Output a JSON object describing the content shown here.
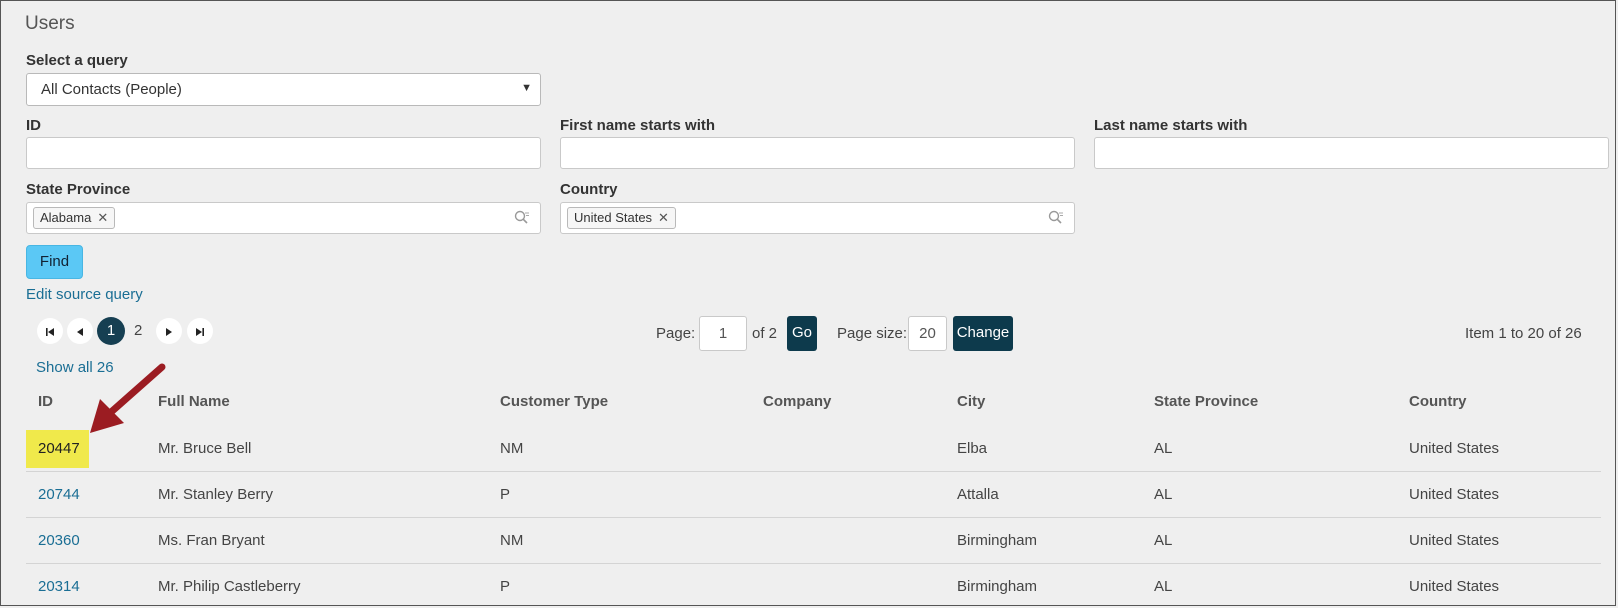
{
  "page": {
    "title": "Users"
  },
  "query": {
    "label": "Select a query",
    "selected": "All Contacts (People)"
  },
  "filters": {
    "id_label": "ID",
    "first_name_label": "First name starts with",
    "last_name_label": "Last name starts with",
    "state_label": "State Province",
    "state_tag": "Alabama",
    "country_label": "Country",
    "country_tag": "United States",
    "tag_remove": "✕"
  },
  "actions": {
    "find": "Find",
    "edit_source": "Edit source query",
    "show_all": "Show all 26"
  },
  "pager": {
    "page_label": "Page:",
    "page_value": "1",
    "of_text": "of 2",
    "go": "Go",
    "size_label": "Page size:",
    "size_value": "20",
    "change": "Change",
    "current": "1",
    "next_page": "2",
    "item_summary": "Item 1 to 20 of 26"
  },
  "table": {
    "headers": [
      "ID",
      "Full Name",
      "Customer Type",
      "Company",
      "City",
      "State Province",
      "Country"
    ],
    "rows": [
      [
        "20447",
        "Mr. Bruce Bell",
        "NM",
        "",
        "Elba",
        "AL",
        "United States"
      ],
      [
        "20744",
        "Mr. Stanley Berry",
        "P",
        "",
        "Attalla",
        "AL",
        "United States"
      ],
      [
        "20360",
        "Ms. Fran Bryant",
        "NM",
        "",
        "Birmingham",
        "AL",
        "United States"
      ],
      [
        "20314",
        "Mr. Philip Castleberry",
        "P",
        "",
        "Birmingham",
        "AL",
        "United States"
      ]
    ]
  },
  "annotation": {
    "highlight_color": "#f0e94b",
    "arrow_color": "#9b1c22"
  }
}
